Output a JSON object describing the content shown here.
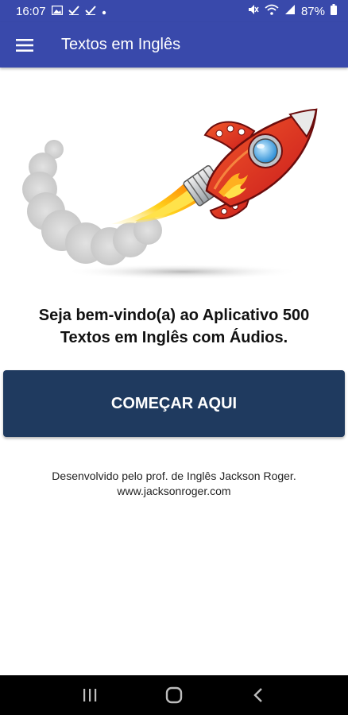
{
  "status_bar": {
    "time": "16:07",
    "battery": "87%",
    "icons": [
      "image-icon",
      "check-icon",
      "check-icon",
      "dot-icon",
      "mute-icon",
      "wifi-icon",
      "signal-icon",
      "battery-icon"
    ]
  },
  "app_bar": {
    "title": "Textos em Inglês",
    "menu_icon": "hamburger-menu-icon"
  },
  "hero": {
    "image": "rocket-illustration"
  },
  "main": {
    "welcome_line1": "Seja bem-vindo(a) ao Aplicativo 500",
    "welcome_line2": "Textos em Inglês com Áudios.",
    "start_button": "COMEÇAR AQUI",
    "credit_line1": "Desenvolvido pelo prof. de Inglês Jackson Roger.",
    "credit_line2": "www.jacksonroger.com"
  },
  "nav_bar": {
    "buttons": [
      "recent-apps-icon",
      "home-icon",
      "back-icon"
    ]
  },
  "colors": {
    "primary": "#3949ab",
    "button": "#1f3a5f",
    "nav": "#000000"
  }
}
